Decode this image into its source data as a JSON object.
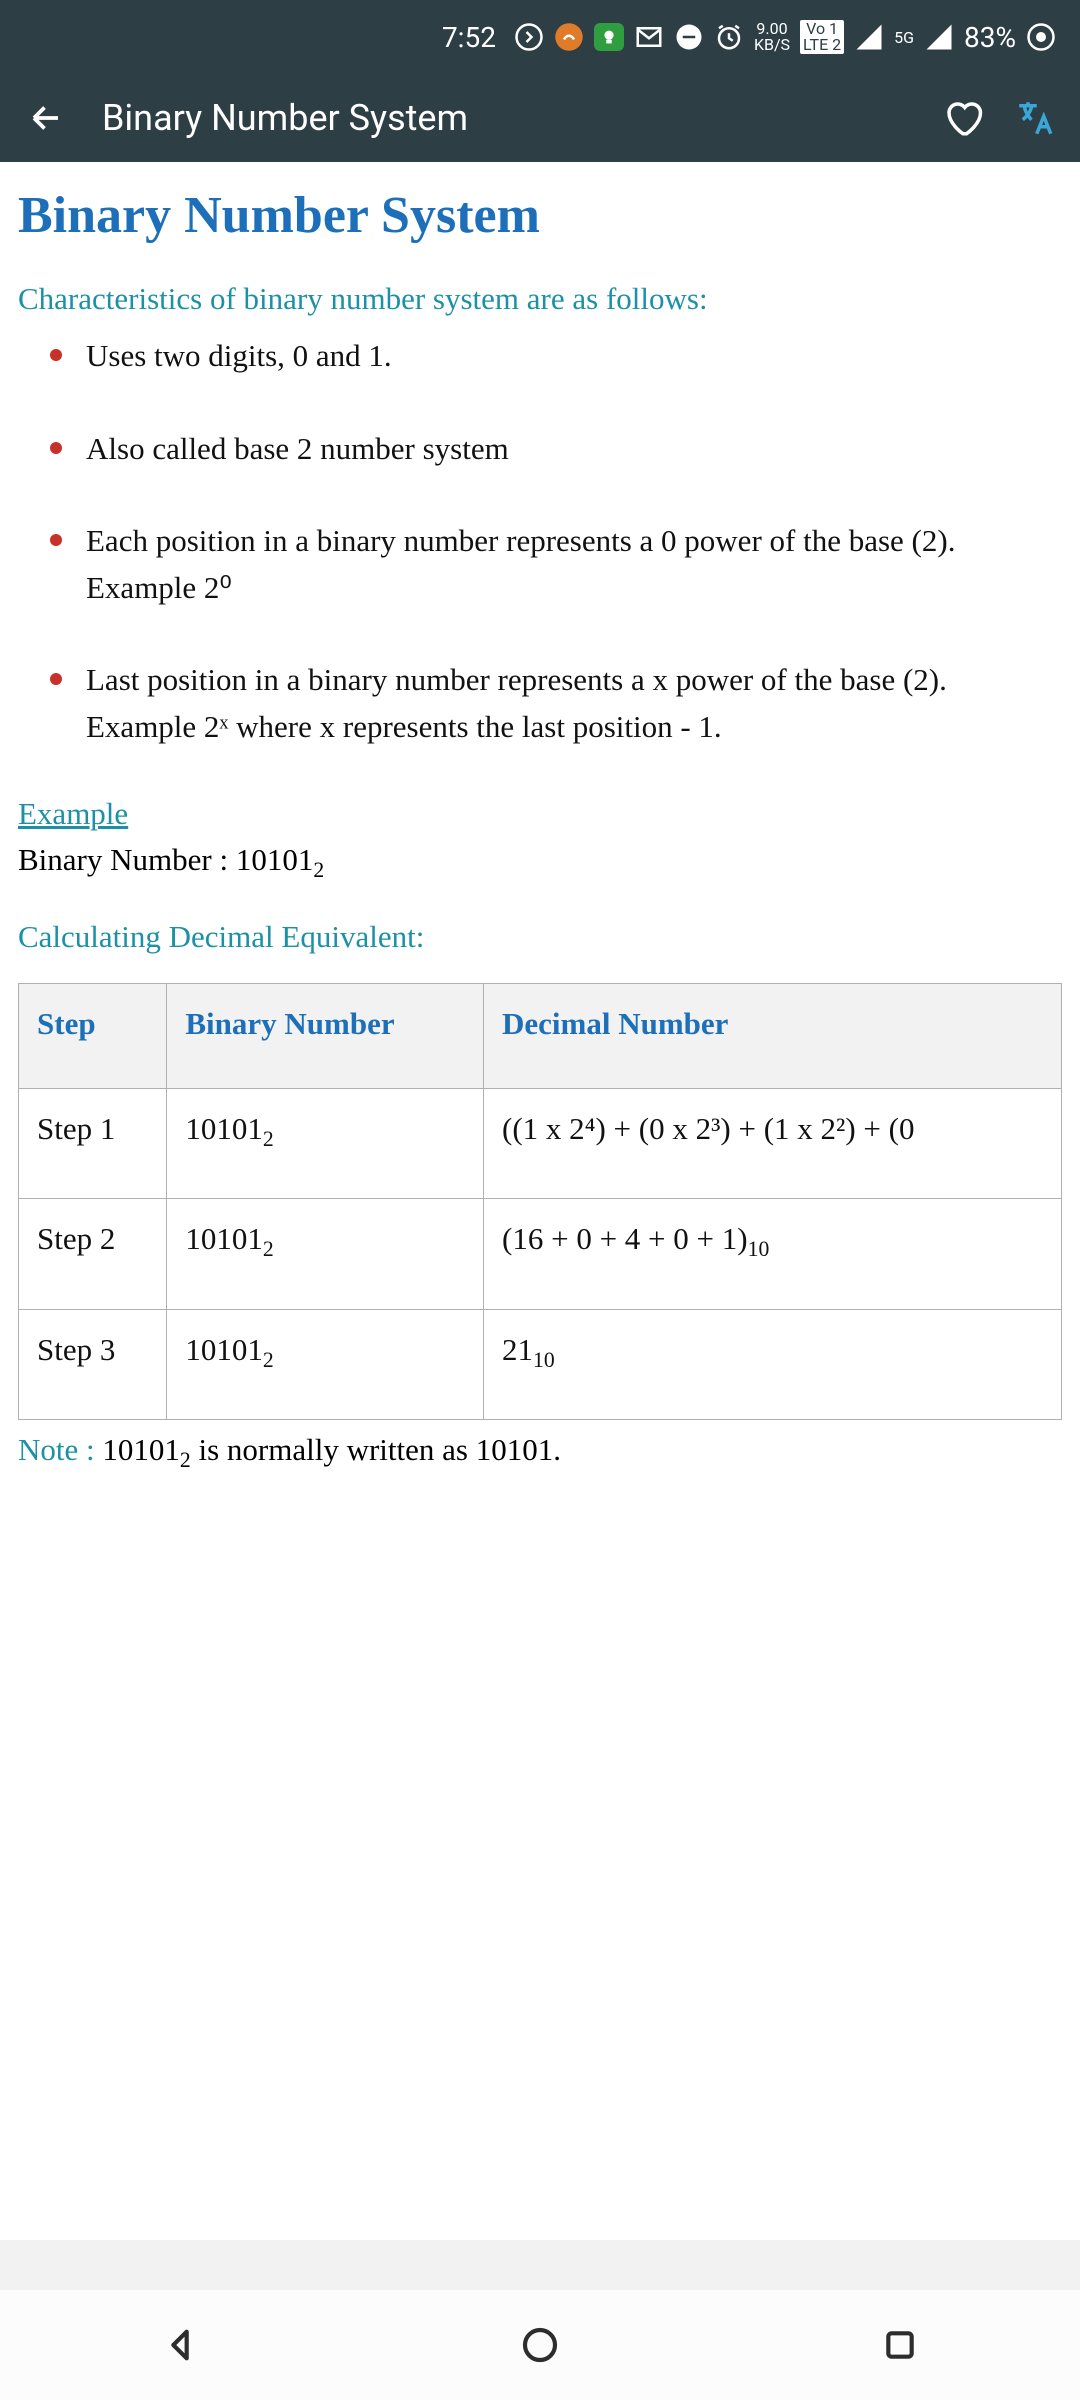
{
  "status": {
    "time": "7:52",
    "speed_top": "9.00",
    "speed_bottom": "KB/S",
    "net_top": "Vo 1",
    "net_bottom": "LTE 2",
    "signal_label": "5G",
    "battery": "83%"
  },
  "appbar": {
    "title": "Binary Number System"
  },
  "page": {
    "heading": "Binary Number System",
    "intro": "Characteristics of binary number system are as follows:",
    "bullets": [
      "Uses two digits, 0 and 1.",
      "Also called base 2 number system",
      "Each position in a binary number represents a 0 power of the base (2). Example 2⁰",
      "Last position in a binary number represents a x power of the base (2). Example 2ˣ where x represents the last position - 1."
    ],
    "example_label": "Example",
    "example_text_prefix": "Binary Number : 10101",
    "example_text_sub": "2",
    "calc_label": "Calculating Decimal Equivalent:",
    "table": {
      "headers": [
        "Step",
        "Binary Number",
        "Decimal Number"
      ],
      "rows": [
        {
          "step": "Step 1",
          "bin_main": "10101",
          "bin_sub": "2",
          "dec_html": "((1 x 2⁴) + (0 x 2³) + (1 x 2²) + (0 "
        },
        {
          "step": "Step 2",
          "bin_main": "10101",
          "bin_sub": "2",
          "dec_main": "(16 + 0 + 4 + 0 + 1)",
          "dec_sub": "10"
        },
        {
          "step": "Step 3",
          "bin_main": "10101",
          "bin_sub": "2",
          "dec_main": "21",
          "dec_sub": "10"
        }
      ]
    },
    "note_label": "Note : ",
    "note_main1": "10101",
    "note_sub": "2",
    "note_main2": " is normally written as 10101."
  }
}
